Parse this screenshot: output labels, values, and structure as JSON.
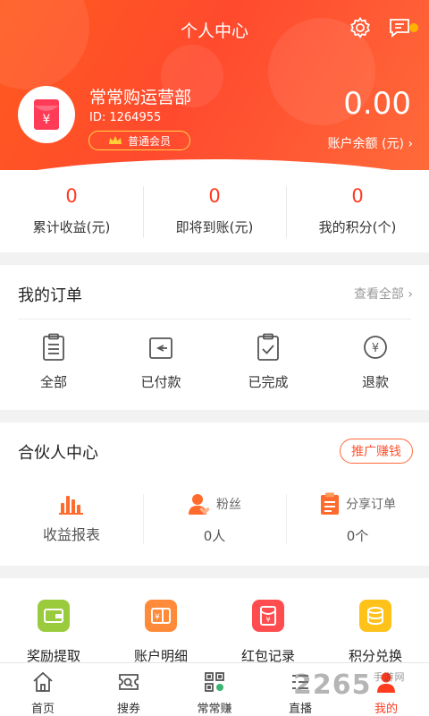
{
  "header": {
    "title": "个人中心",
    "bg_color": "#ff5a1e",
    "icons": [
      "gear-icon",
      "message-icon"
    ]
  },
  "user": {
    "name": "常常购运营部",
    "id_text": "ID: 1264955",
    "level": "普通会员",
    "balance": "0.00",
    "balance_label": "账户余额 (元) ›"
  },
  "stats": [
    {
      "value": "0",
      "label": "累计收益(元)"
    },
    {
      "value": "0",
      "label": "即将到账(元)"
    },
    {
      "value": "0",
      "label": "我的积分(个)"
    }
  ],
  "orders": {
    "title": "我的订单",
    "view_all": "查看全部 ›",
    "items": [
      {
        "label": "全部",
        "icon": "clipboard-list-icon"
      },
      {
        "label": "已付款",
        "icon": "payment-icon"
      },
      {
        "label": "已完成",
        "icon": "completed-check-icon"
      },
      {
        "label": "退款",
        "icon": "refund-yen-icon"
      }
    ]
  },
  "partner": {
    "title": "合伙人中心",
    "promo_button": "推广赚钱",
    "items": [
      {
        "label": "收益报表",
        "value": "",
        "icon": "bar-chart-icon"
      },
      {
        "label": "粉丝",
        "value": "0人",
        "icon": "fans-icon"
      },
      {
        "label": "分享订单",
        "value": "0个",
        "icon": "share-order-icon"
      }
    ]
  },
  "tools": [
    {
      "label": "奖励提取",
      "icon": "wallet-icon",
      "color": "#9acb3c"
    },
    {
      "label": "账户明细",
      "icon": "account-detail-icon",
      "color": "#ff8a3a"
    },
    {
      "label": "红包记录",
      "icon": "red-packet-icon",
      "color": "#ff4d4f"
    },
    {
      "label": "积分兑换",
      "icon": "coins-icon",
      "color": "#ffc21a"
    }
  ],
  "tabbar": [
    {
      "label": "首页",
      "icon": "home-icon",
      "active": false
    },
    {
      "label": "搜券",
      "icon": "search-coupon-icon",
      "active": false
    },
    {
      "label": "常常赚",
      "icon": "qr-code-icon",
      "active": false
    },
    {
      "label": "直播",
      "icon": "live-icon",
      "active": false
    },
    {
      "label": "我的",
      "icon": "profile-icon",
      "active": true
    }
  ],
  "watermark": {
    "main": "2265",
    "sub": "手游网"
  }
}
